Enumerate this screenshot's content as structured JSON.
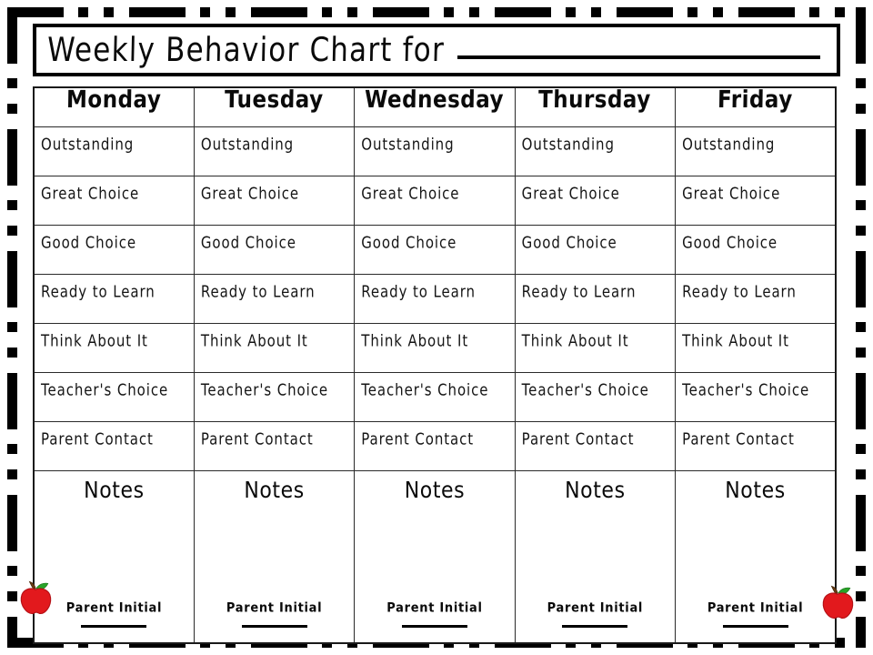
{
  "page": {
    "title": "Weekly Behavior Chart for",
    "name_blank_label": "student-name-blank"
  },
  "frame": {
    "style": "dashed-border",
    "color": "#000000"
  },
  "chart_table": {
    "columns": [
      "Monday",
      "Tuesday",
      "Wednesday",
      "Thursday",
      "Friday"
    ],
    "levels": [
      "Outstanding",
      "Great Choice",
      "Good Choice",
      "Ready to Learn",
      "Think About It",
      "Teacher's Choice",
      "Parent Contact"
    ],
    "notes_heading": "Notes",
    "parent_initial_label": "Parent Initial"
  },
  "decorations": {
    "apple_body_color": "#e2191d",
    "apple_leaf_color": "#29a329",
    "apple_stem_color": "#6b3d12",
    "apple_left_name": "apple-icon",
    "apple_right_name": "apple-icon"
  }
}
